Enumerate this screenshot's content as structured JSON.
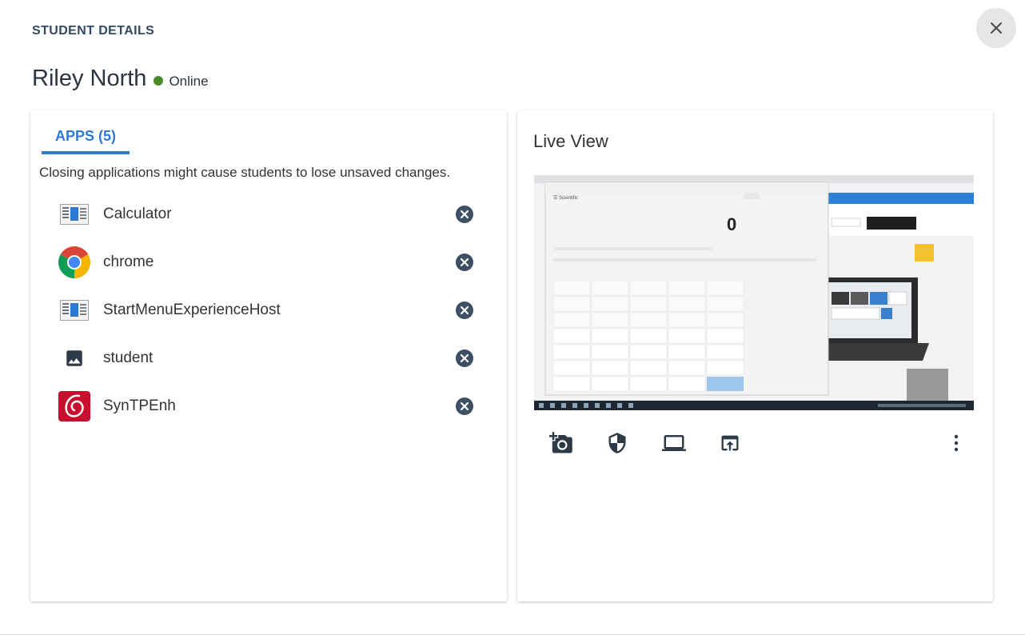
{
  "header": {
    "title": "STUDENT DETAILS"
  },
  "student": {
    "name": "Riley North",
    "status": "Online"
  },
  "apps": {
    "tab_label": "APPS (5)",
    "warning": "Closing applications might cause students to lose unsaved changes.",
    "items": [
      {
        "name": "Calculator",
        "icon": "window-app-icon"
      },
      {
        "name": "chrome",
        "icon": "chrome-icon"
      },
      {
        "name": "StartMenuExperienceHost",
        "icon": "window-app-icon"
      },
      {
        "name": "student",
        "icon": "image-icon"
      },
      {
        "name": "SynTPEnh",
        "icon": "synaptics-icon"
      }
    ]
  },
  "live_view": {
    "title": "Live View",
    "calculator_mode": "Scientific",
    "calculator_display": "0",
    "toolbar": [
      "add-screenshot-icon",
      "shield-icon",
      "laptop-icon",
      "open-in-browser-icon",
      "more-vertical-icon"
    ]
  },
  "colors": {
    "accent": "#2e7bd4",
    "online": "#4a8a2c",
    "close_icon": "#3d4f63"
  }
}
